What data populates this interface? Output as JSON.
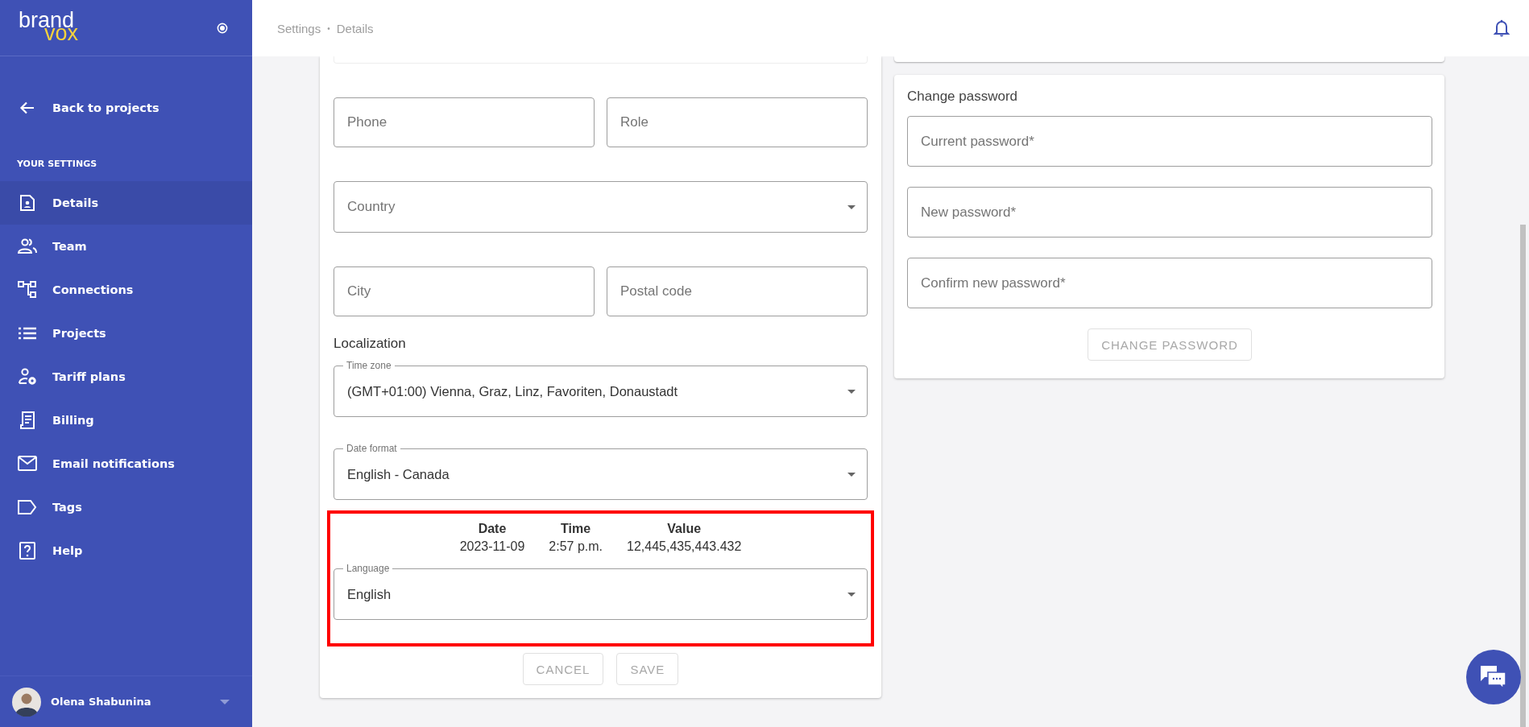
{
  "sidebar": {
    "logo": {
      "word_1": "brand",
      "word_2": "vox"
    },
    "back_link": "Back to projects",
    "section_title": "YOUR SETTINGS",
    "items": [
      {
        "label": "Details",
        "selected": true
      },
      {
        "label": "Team",
        "selected": false
      },
      {
        "label": "Connections",
        "selected": false
      },
      {
        "label": "Projects",
        "selected": false
      },
      {
        "label": "Tariff plans",
        "selected": false
      },
      {
        "label": "Billing",
        "selected": false
      },
      {
        "label": "Email notifications",
        "selected": false
      },
      {
        "label": "Tags",
        "selected": false
      },
      {
        "label": "Help",
        "selected": false
      }
    ],
    "user": {
      "name": "Olena Shabunina"
    }
  },
  "header": {
    "breadcrumb": [
      "Settings",
      "Details"
    ],
    "separator": "•"
  },
  "details_form": {
    "rows": [
      [
        {
          "kind": "text",
          "placeholder": "Phone"
        },
        {
          "kind": "text",
          "placeholder": "Role"
        }
      ],
      [
        {
          "kind": "select",
          "placeholder": "Country"
        }
      ],
      [
        {
          "kind": "text",
          "placeholder": "City"
        },
        {
          "kind": "text",
          "placeholder": "Postal code"
        }
      ]
    ],
    "localization": {
      "title": "Localization",
      "time_zone": {
        "label": "Time zone",
        "value": "(GMT+01:00) Vienna, Graz, Linz, Favoriten, Donaustadt"
      },
      "date_format": {
        "label": "Date format",
        "value": "English - Canada"
      },
      "preview": {
        "highlighted": true,
        "columns": [
          {
            "heading": "Date",
            "value": "2023-11-09"
          },
          {
            "heading": "Time",
            "value": "2:57 p.m."
          },
          {
            "heading": "Value",
            "value": "12,445,435,443.432"
          }
        ]
      },
      "language": {
        "label": "Language",
        "value": "English"
      }
    },
    "buttons": [
      {
        "label": "CANCEL",
        "disabled": true
      },
      {
        "label": "SAVE",
        "disabled": true
      }
    ]
  },
  "password_card": {
    "title": "Change password",
    "fields": [
      {
        "placeholder": "Current password*"
      },
      {
        "placeholder": "New password*"
      },
      {
        "placeholder": "Confirm new password*"
      }
    ],
    "button": {
      "label": "CHANGE PASSWORD",
      "disabled": true
    }
  }
}
